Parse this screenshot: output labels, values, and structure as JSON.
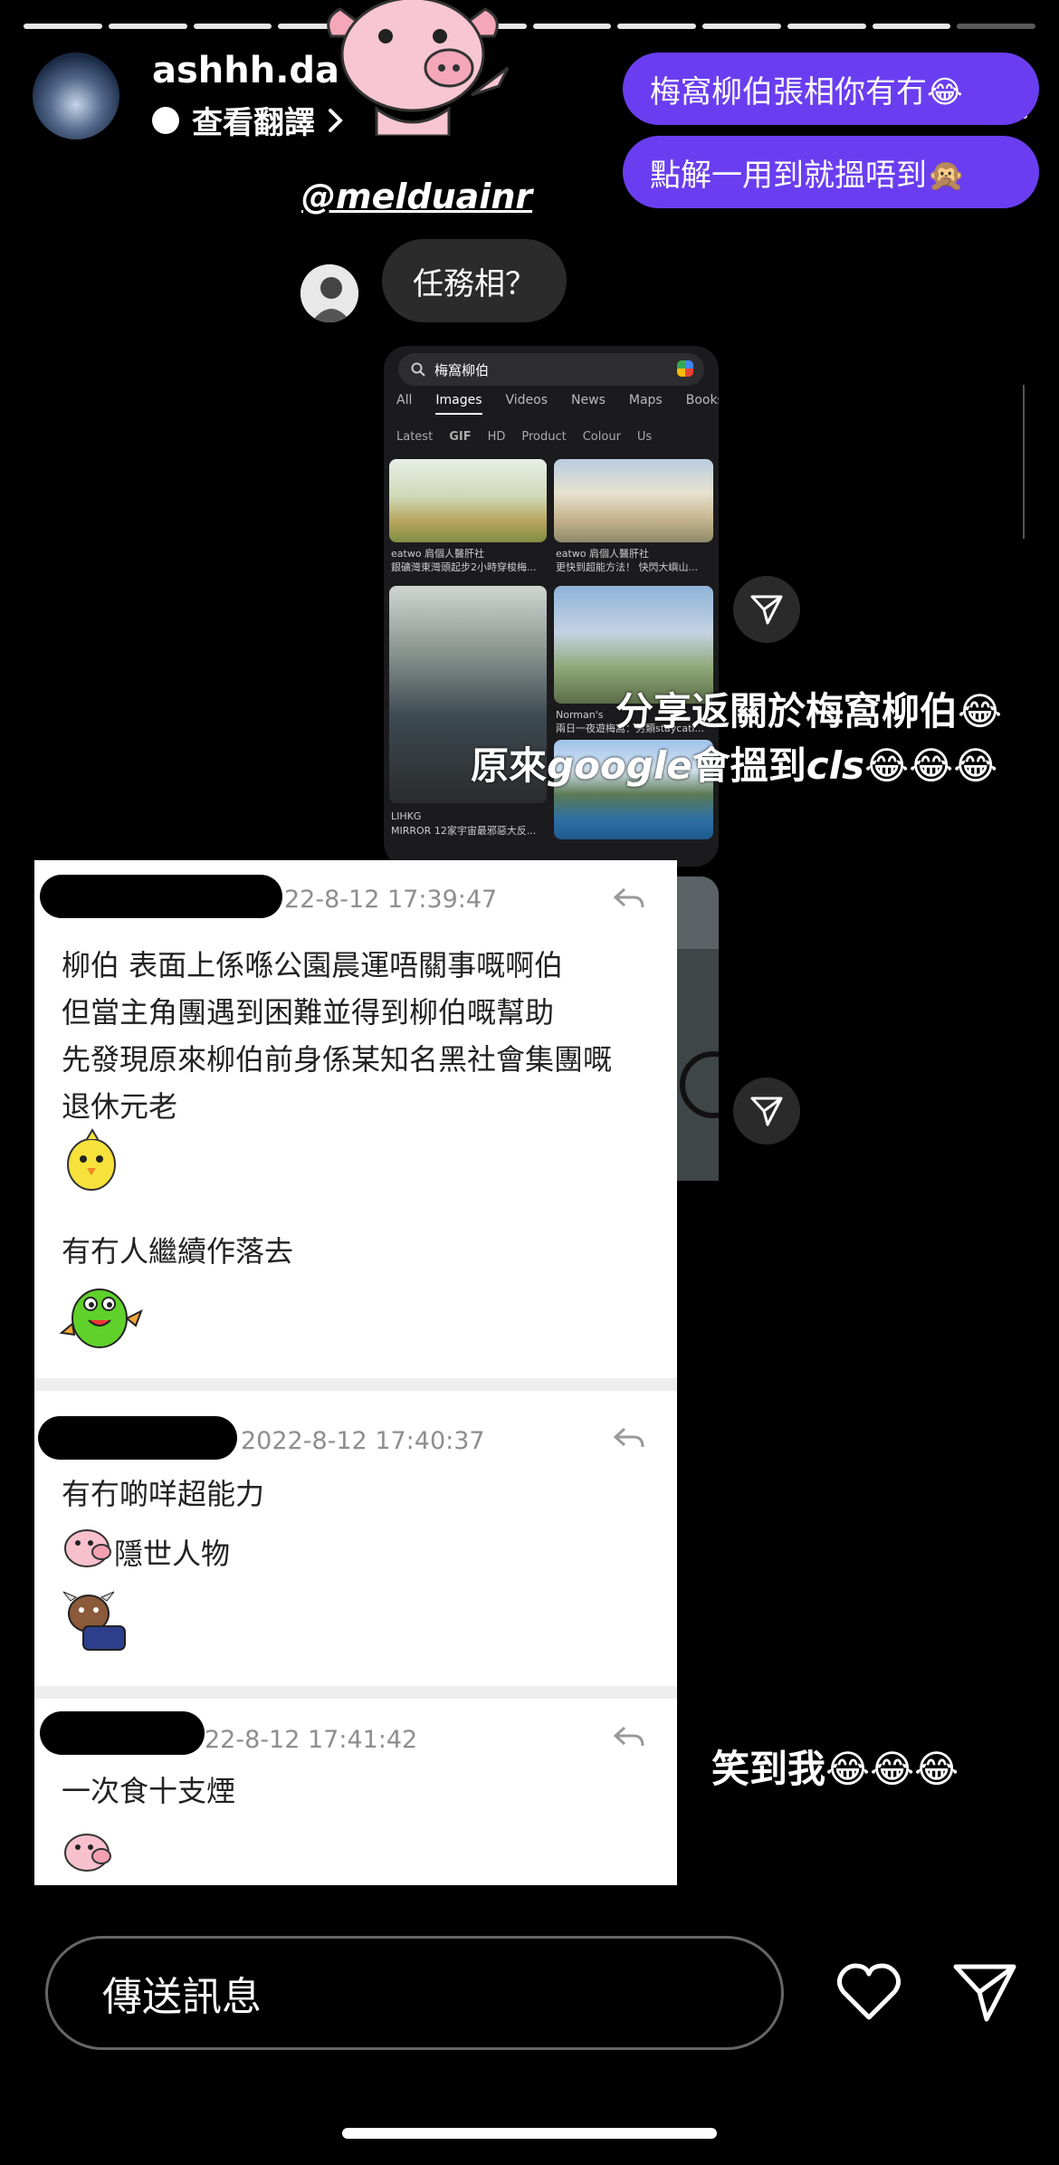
{
  "header": {
    "username": "ashhh.da",
    "translate_label": "查看翻譯"
  },
  "dm_bubbles": [
    {
      "text": "梅窩柳伯張相你有冇😂"
    },
    {
      "text": "點解一用到就搵唔到🙊"
    }
  ],
  "mention": "@melduainr",
  "reply_bubble": "任務相？",
  "screenshot": {
    "search_query": "梅窩柳伯",
    "tabs": [
      "All",
      "Images",
      "Videos",
      "News",
      "Maps",
      "Books"
    ],
    "active_tab": "Images",
    "filters": [
      "Latest",
      "GIF",
      "HD",
      "Product",
      "Colour",
      "Us"
    ],
    "captions": [
      {
        "source": "eatwo 肩個人醫肝社",
        "title": "銀礦灣東灣頭起步2小時穿梭梅..."
      },
      {
        "source": "eatwo 肩個人醫肝社",
        "title": "更快到超能方法！ 快閃大嶼山..."
      },
      {
        "source": "LIHKG",
        "title": "MIRROR 12家宇宙最邪惡大反..."
      },
      {
        "source": "Norman's",
        "title": "兩日一夜遊梅窩：另類staycati..."
      }
    ]
  },
  "overlay_texts": {
    "line1": "分享返關於梅窩柳伯😂",
    "line2_pre": "原來",
    "line2_google": "google",
    "line2_mid": "會搵到",
    "line2_cls": "cls",
    "line2_post": "😂😂😂",
    "line3": "笑到我😂😂😂"
  },
  "forum": {
    "posts": [
      {
        "timestamp": "22-8-12 17:39:47",
        "lines": [
          "柳伯 表面上係喺公園晨運唔關事嘅啊伯",
          "但當主角團遇到困難並得到柳伯嘅幫助",
          "先發現原來柳伯前身係某知名黑社會集團嘅",
          "退休元老"
        ],
        "line2": "有冇人繼續作落去"
      },
      {
        "timestamp": "2022-8-12 17:40:37",
        "lines": [
          "有冇啲咩超能力"
        ],
        "line2": "隱世人物"
      },
      {
        "timestamp": "22-8-12 17:41:42",
        "lines": [
          "一次食十支煙"
        ]
      }
    ]
  },
  "composer": {
    "placeholder": "傳送訊息"
  },
  "colors": {
    "purple_bubble": "#6a3ef0",
    "background": "#000000"
  }
}
